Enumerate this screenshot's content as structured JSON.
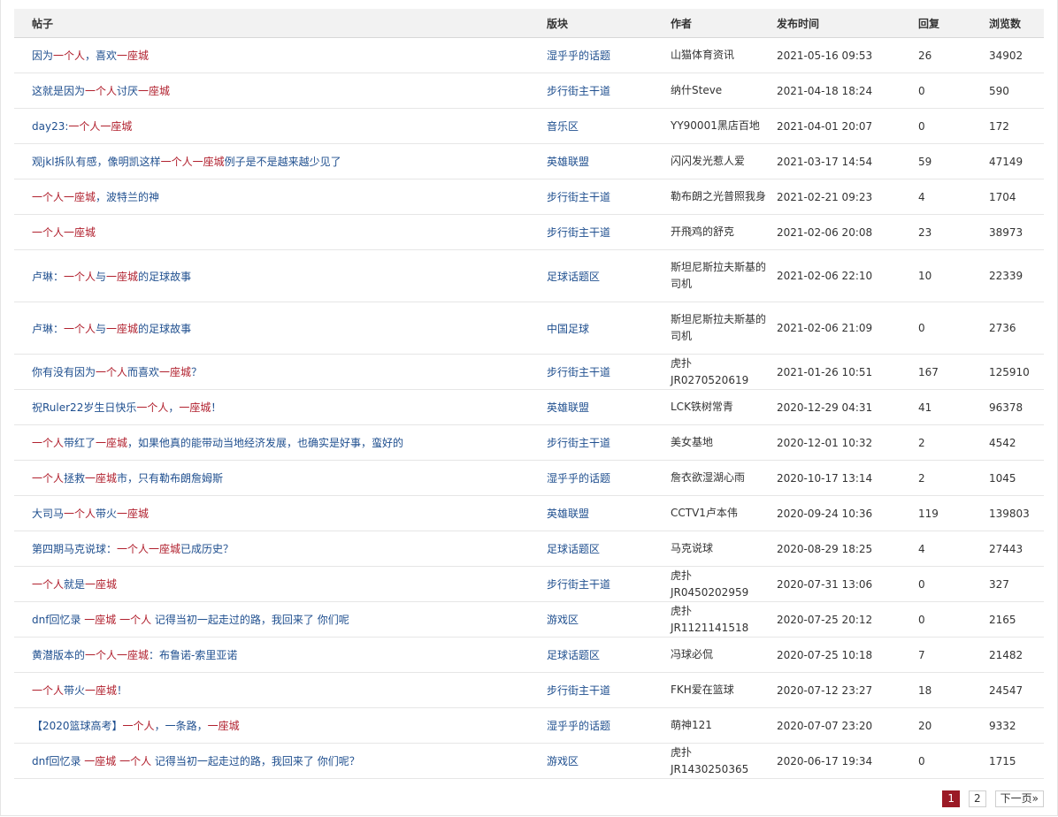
{
  "columns": {
    "title": "帖子",
    "forum": "版块",
    "author": "作者",
    "time": "发布时间",
    "replies": "回复",
    "views": "浏览数"
  },
  "colors": {
    "link": "#1f4f8f",
    "highlight": "#b01e2c",
    "pager_active": "#9b1a26"
  },
  "rows": [
    {
      "title": [
        [
          "因为",
          "n"
        ],
        [
          "一个人",
          "h"
        ],
        [
          "，喜欢",
          "n"
        ],
        [
          "一座城",
          "h"
        ]
      ],
      "forum": "湿乎乎的话题",
      "author": "山猫体育资讯",
      "time": "2021-05-16 09:53",
      "replies": "26",
      "views": "34902"
    },
    {
      "title": [
        [
          "这就是因为",
          "n"
        ],
        [
          "一个人",
          "h"
        ],
        [
          "讨厌",
          "n"
        ],
        [
          "一座城",
          "h"
        ]
      ],
      "forum": "步行街主干道",
      "author": "纳什Steve",
      "time": "2021-04-18 18:24",
      "replies": "0",
      "views": "590"
    },
    {
      "title": [
        [
          "day23:",
          "n"
        ],
        [
          "一个人一座城",
          "h"
        ]
      ],
      "forum": "音乐区",
      "author": "YY90001黑店百地",
      "time": "2021-04-01 20:07",
      "replies": "0",
      "views": "172"
    },
    {
      "title": [
        [
          "观jkl拆队有感，像明凯这样",
          "n"
        ],
        [
          "一个人一座城",
          "h"
        ],
        [
          "例子是不是越来越少见了",
          "n"
        ]
      ],
      "forum": "英雄联盟",
      "author": "闪闪发光惹人爱",
      "time": "2021-03-17 14:54",
      "replies": "59",
      "views": "47149"
    },
    {
      "title": [
        [
          "一个人一座城",
          "h"
        ],
        [
          "，波特兰的神",
          "n"
        ]
      ],
      "forum": "步行街主干道",
      "author": "勒布朗之光普照我身",
      "time": "2021-02-21 09:23",
      "replies": "4",
      "views": "1704"
    },
    {
      "title": [
        [
          "一个人一座城",
          "h"
        ]
      ],
      "forum": "步行街主干道",
      "author": "开飛鸡的舒克",
      "time": "2021-02-06 20:08",
      "replies": "23",
      "views": "38973"
    },
    {
      "title": [
        [
          "卢琳：",
          "n"
        ],
        [
          "一个人",
          "h"
        ],
        [
          "与",
          "n"
        ],
        [
          "一座城",
          "h"
        ],
        [
          "的足球故事",
          "n"
        ]
      ],
      "forum": "足球话题区",
      "author": "斯坦尼斯拉夫斯基的司机",
      "time": "2021-02-06 22:10",
      "replies": "10",
      "views": "22339",
      "tall": true
    },
    {
      "title": [
        [
          "卢琳：",
          "n"
        ],
        [
          "一个人",
          "h"
        ],
        [
          "与",
          "n"
        ],
        [
          "一座城",
          "h"
        ],
        [
          "的足球故事",
          "n"
        ]
      ],
      "forum": "中国足球",
      "author": "斯坦尼斯拉夫斯基的司机",
      "time": "2021-02-06 21:09",
      "replies": "0",
      "views": "2736",
      "tall": true
    },
    {
      "title": [
        [
          "你有没有因为",
          "n"
        ],
        [
          "一个人",
          "h"
        ],
        [
          "而喜欢",
          "n"
        ],
        [
          "一座城",
          "h"
        ],
        [
          "？",
          "n"
        ]
      ],
      "forum": "步行街主干道",
      "author": "虎扑JR0270520619",
      "time": "2021-01-26 10:51",
      "replies": "167",
      "views": "125910"
    },
    {
      "title": [
        [
          "祝Ruler22岁生日快乐",
          "n"
        ],
        [
          "一个人",
          "h"
        ],
        [
          "，",
          "n"
        ],
        [
          "一座城",
          "h"
        ],
        [
          "！",
          "n"
        ]
      ],
      "forum": "英雄联盟",
      "author": "LCK铁树常青",
      "time": "2020-12-29 04:31",
      "replies": "41",
      "views": "96378"
    },
    {
      "title": [
        [
          "一个人",
          "h"
        ],
        [
          "带红了",
          "n"
        ],
        [
          "一座城",
          "h"
        ],
        [
          "，如果他真的能带动当地经济发展，也确实是好事，蛮好的",
          "n"
        ]
      ],
      "forum": "步行街主干道",
      "author": "美女基地",
      "time": "2020-12-01 10:32",
      "replies": "2",
      "views": "4542"
    },
    {
      "title": [
        [
          "一个人",
          "h"
        ],
        [
          "拯救",
          "n"
        ],
        [
          "一座城",
          "h"
        ],
        [
          "市，只有勒布朗詹姆斯",
          "n"
        ]
      ],
      "forum": "湿乎乎的话题",
      "author": "詹衣欲湿湖心雨",
      "time": "2020-10-17 13:14",
      "replies": "2",
      "views": "1045"
    },
    {
      "title": [
        [
          "大司马",
          "n"
        ],
        [
          "一个人",
          "h"
        ],
        [
          "带火",
          "n"
        ],
        [
          "一座城",
          "h"
        ]
      ],
      "forum": "英雄联盟",
      "author": "CCTV1卢本伟",
      "time": "2020-09-24 10:36",
      "replies": "119",
      "views": "139803"
    },
    {
      "title": [
        [
          "第四期马克说球：",
          "n"
        ],
        [
          "一个人一座城",
          "h"
        ],
        [
          "已成历史？",
          "n"
        ]
      ],
      "forum": "足球话题区",
      "author": "马克说球",
      "time": "2020-08-29 18:25",
      "replies": "4",
      "views": "27443"
    },
    {
      "title": [
        [
          "一个人",
          "h"
        ],
        [
          "就是",
          "n"
        ],
        [
          "一座城",
          "h"
        ]
      ],
      "forum": "步行街主干道",
      "author": "虎扑JR0450202959",
      "time": "2020-07-31 13:06",
      "replies": "0",
      "views": "327"
    },
    {
      "title": [
        [
          "dnf回忆录 ",
          "n"
        ],
        [
          "一座城 一个人",
          "h"
        ],
        [
          " 记得当初一起走过的路，我回来了 你们呢",
          "n"
        ]
      ],
      "forum": "游戏区",
      "author": "虎扑JR1121141518",
      "time": "2020-07-25 20:12",
      "replies": "0",
      "views": "2165"
    },
    {
      "title": [
        [
          "黄潜版本的",
          "n"
        ],
        [
          "一个人一座城",
          "h"
        ],
        [
          "：布鲁诺-索里亚诺",
          "n"
        ]
      ],
      "forum": "足球话题区",
      "author": "冯球必侃",
      "time": "2020-07-25 10:18",
      "replies": "7",
      "views": "21482"
    },
    {
      "title": [
        [
          "一个人",
          "h"
        ],
        [
          "带火",
          "n"
        ],
        [
          "一座城",
          "h"
        ],
        [
          "！",
          "n"
        ]
      ],
      "forum": "步行街主干道",
      "author": "FKH爱在篮球",
      "time": "2020-07-12 23:27",
      "replies": "18",
      "views": "24547"
    },
    {
      "title": [
        [
          "【2020篮球高考】",
          "n"
        ],
        [
          "一个人",
          "h"
        ],
        [
          "，一条路，",
          "n"
        ],
        [
          "一座城",
          "h"
        ]
      ],
      "forum": "湿乎乎的话题",
      "author": "萌神121",
      "time": "2020-07-07 23:20",
      "replies": "20",
      "views": "9332"
    },
    {
      "title": [
        [
          "dnf回忆录 ",
          "n"
        ],
        [
          "一座城 一个人",
          "h"
        ],
        [
          " 记得当初一起走过的路，我回来了 你们呢？",
          "n"
        ]
      ],
      "forum": "游戏区",
      "author": "虎扑JR1430250365",
      "time": "2020-06-17 19:34",
      "replies": "0",
      "views": "1715"
    }
  ],
  "pagination": {
    "pages": [
      "1",
      "2"
    ],
    "current": "1",
    "next_label": "下一页»"
  }
}
